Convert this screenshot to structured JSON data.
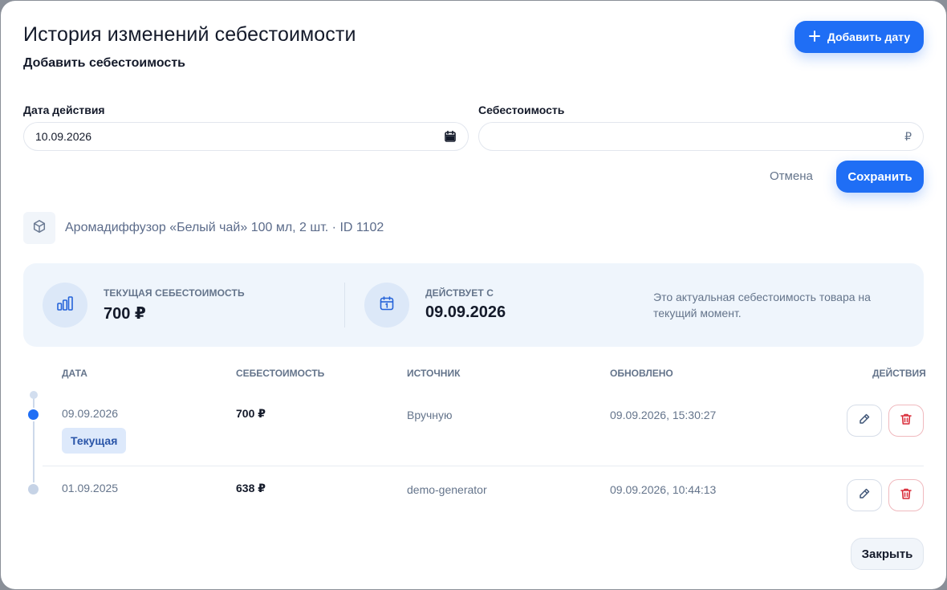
{
  "modal": {
    "title": "История изменений себестоимости",
    "subtitle": "Добавить себестоимость",
    "add_date_button": "Добавить дату"
  },
  "form": {
    "date_label": "Дата действия",
    "date_value": "10.09.2026",
    "cost_label": "Себестоимость",
    "cost_value": "",
    "currency_suffix": "₽",
    "cancel_label": "Отмена",
    "save_label": "Сохранить"
  },
  "product": {
    "name": "Аромадиффузор «Белый чай» 100 мл, 2 шт. · ID 1102"
  },
  "summary": {
    "current_cost_label": "Текущая себестоимость",
    "current_cost_value": "700 ₽",
    "effective_label": "Действует с",
    "effective_value": "09.09.2026",
    "note": "Это актуальная себестоимость товара на текущий момент."
  },
  "table": {
    "headers": {
      "date": "Дата",
      "cost": "Себестоимость",
      "source": "Источник",
      "updated": "Обновлено",
      "actions": "Действия"
    },
    "rows": [
      {
        "date": "09.09.2026",
        "badge": "Текущая",
        "cost": "700 ₽",
        "source": "Вручную",
        "updated": "09.09.2026, 15:30:27"
      },
      {
        "date": "01.09.2025",
        "badge": "",
        "cost": "638 ₽",
        "source": "demo-generator",
        "updated": "09.09.2026, 10:44:13"
      }
    ]
  },
  "footer": {
    "close_label": "Закрыть"
  },
  "colors": {
    "accent": "#1f6ef5",
    "danger": "#d92d3a",
    "summary_bg": "#eff5fc",
    "badge_bg": "#dde9fb"
  },
  "icons": [
    "plus-icon",
    "calendar-picker-icon",
    "box-icon",
    "bar-chart-icon",
    "calendar-icon",
    "edit-icon",
    "trash-icon"
  ]
}
